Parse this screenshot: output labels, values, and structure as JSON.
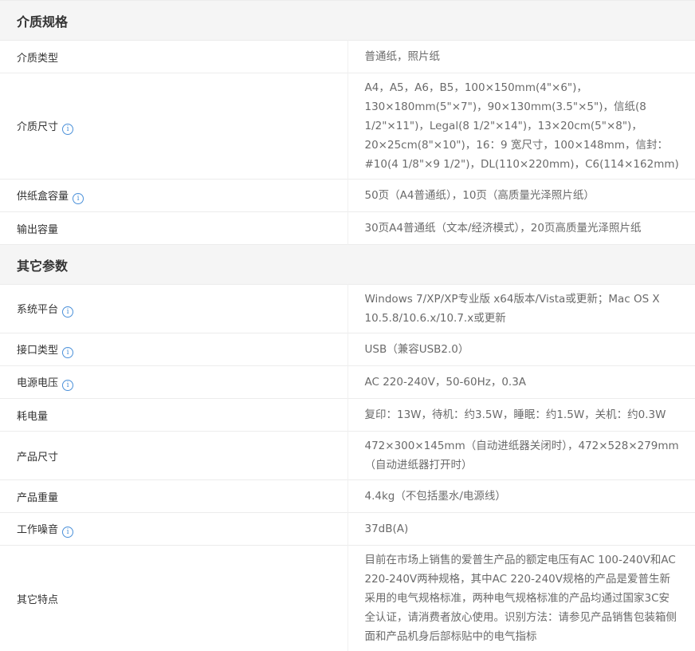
{
  "sections": [
    {
      "title": "介质规格",
      "rows": [
        {
          "label": "介质类型",
          "value": "普通纸，照片纸"
        },
        {
          "label": "介质尺寸",
          "value": "A4，A5，A6，B5，100×150mm(4\"×6\")，130×180mm(5\"×7\")，90×130mm(3.5\"×5\")，信纸(8 1/2\"×11\")，Legal(8 1/2\"×14\")，13×20cm(5\"×8\")，20×25cm(8\"×10\")，16：9 宽尺寸，100×148mm，信封：#10(4 1/8\"×9 1/2\")，DL(110×220mm)，C6(114×162mm)",
          "info_icon": "info-icon"
        },
        {
          "label": "供纸盒容量",
          "value": "50页（A4普通纸），10页（高质量光泽照片纸）",
          "info_icon": "info-icon"
        },
        {
          "label": "输出容量",
          "value": "30页A4普通纸（文本/经济模式），20页高质量光泽照片纸"
        }
      ]
    },
    {
      "title": "其它参数",
      "rows": [
        {
          "label": "系统平台",
          "value": "Windows 7/XP/XP专业版 x64版本/Vista或更新；Mac OS X 10.5.8/10.6.x/10.7.x或更新",
          "info_icon": "info-icon"
        },
        {
          "label": "接口类型",
          "value": "USB（兼容USB2.0）",
          "info_icon": "info-icon"
        },
        {
          "label": "电源电压",
          "value": "AC 220-240V，50-60Hz，0.3A",
          "info_icon": "info-icon"
        },
        {
          "label": "耗电量",
          "value": "复印：13W，待机：约3.5W，睡眠：约1.5W，关机：约0.3W"
        },
        {
          "label": "产品尺寸",
          "value": "472×300×145mm（自动进纸器关闭时），472×528×279mm（自动进纸器打开时）"
        },
        {
          "label": "产品重量",
          "value": "4.4kg（不包括墨水/电源线）"
        },
        {
          "label": "工作噪音",
          "value": "37dB(A)",
          "info_icon": "info-icon"
        },
        {
          "label": "其它特点",
          "value": "目前在市场上销售的爱普生产品的额定电压有AC 100-240V和AC 220-240V两种规格，其中AC 220-240V规格的产品是爱普生新采用的电气规格标准，两种电气规格标准的产品均通过国家3C安全认证，请消费者放心使用。识别方法：请参见产品销售包装箱侧面和产品机身后部标贴中的电气指标"
        }
      ]
    }
  ],
  "colors": {
    "section_bg": "#f5f5f5",
    "border": "#ececec",
    "label_text": "#333333",
    "value_text": "#6a6a6a",
    "info_icon": "#4a90d9"
  }
}
